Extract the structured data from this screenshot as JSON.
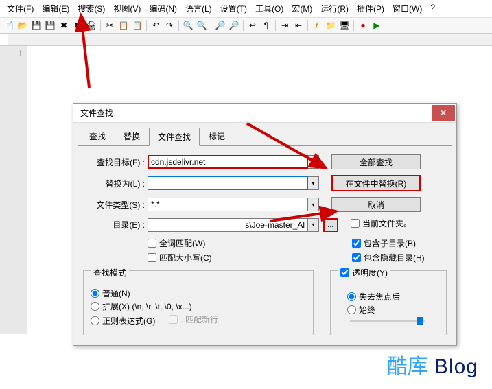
{
  "menu": [
    "文件(F)",
    "编辑(E)",
    "搜索(S)",
    "视图(V)",
    "编码(N)",
    "语言(L)",
    "设置(T)",
    "工具(O)",
    "宏(M)",
    "运行(R)",
    "插件(P)",
    "窗口(W)",
    "?"
  ],
  "gutter_line": "1",
  "dialog": {
    "title": "文件查找",
    "close": "✕",
    "tabs": [
      "查找",
      "替换",
      "文件查找",
      "标记"
    ],
    "active_tab": 2,
    "labels": {
      "find": "查找目标(F) :",
      "replace": "替换为(L) :",
      "filetype": "文件类型(S) :",
      "dir": "目录(E) :"
    },
    "values": {
      "find": "cdn.jsdelivr.net",
      "replace": "",
      "filetype": "*.*",
      "dir": "s\\Joe-master_Al"
    },
    "buttons": {
      "findall": "全部查找",
      "replacein": "在文件中替换(R)",
      "cancel": "取消"
    },
    "checks_left": {
      "whole": "全词匹配(W)",
      "case": "匹配大小写(C)"
    },
    "checks_right": {
      "curdir": "当前文件夹。",
      "subdir": "包含子目录(B)",
      "hidden": "包含隐藏目录(H)"
    },
    "search_mode": {
      "legend": "查找模式",
      "normal": "普通(N)",
      "extended": "扩展(X) (\\n, \\r, \\t, \\0, \\x...)",
      "regex": "正则表达式(G)",
      "newline": ". 匹配新行"
    },
    "transparency": {
      "label": "透明度(Y)",
      "lostfocus": "失去焦点后",
      "always": "始终"
    }
  },
  "watermark": {
    "a": "酷库",
    "b": " Blog"
  }
}
